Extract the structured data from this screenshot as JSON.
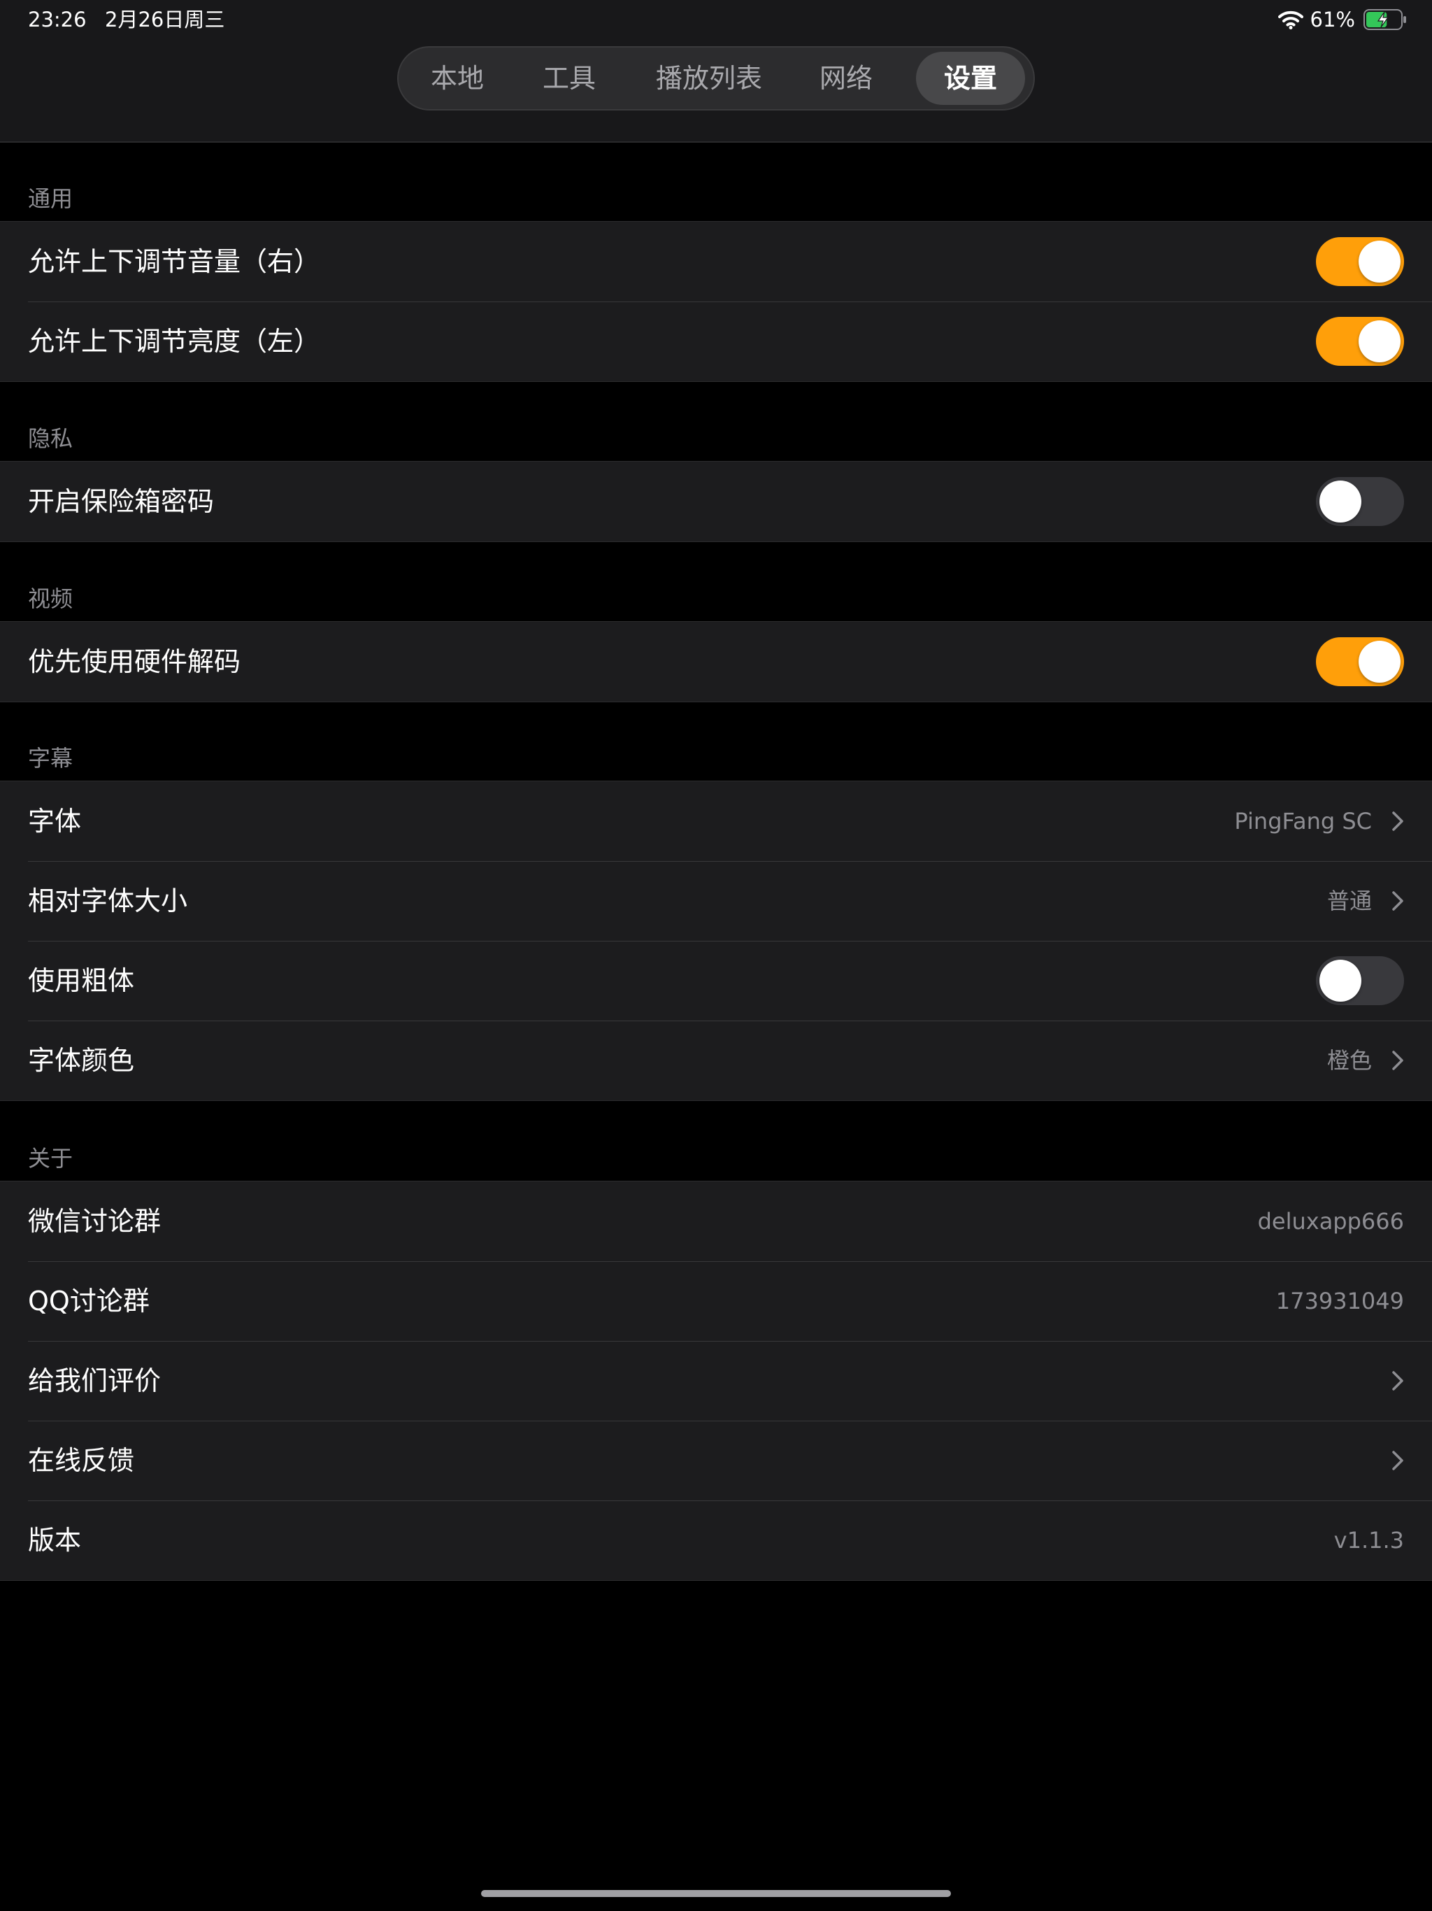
{
  "status_bar": {
    "time": "23:26",
    "date": "2月26日周三",
    "battery_percent": "61%",
    "battery_level": 0.61,
    "charging": true
  },
  "tabs": [
    {
      "label": "本地",
      "active": false
    },
    {
      "label": "工具",
      "active": false
    },
    {
      "label": "播放列表",
      "active": false
    },
    {
      "label": "网络",
      "active": false
    },
    {
      "label": "设置",
      "active": true
    }
  ],
  "sections": {
    "general": {
      "header": "通用",
      "rows": [
        {
          "label": "允许上下调节音量（右）",
          "toggle": true
        },
        {
          "label": "允许上下调节亮度（左）",
          "toggle": true
        }
      ]
    },
    "privacy": {
      "header": "隐私",
      "rows": [
        {
          "label": "开启保险箱密码",
          "toggle": false
        }
      ]
    },
    "video": {
      "header": "视频",
      "rows": [
        {
          "label": "优先使用硬件解码",
          "toggle": true
        }
      ]
    },
    "subtitles": {
      "header": "字幕",
      "rows": [
        {
          "label": "字体",
          "value": "PingFang SC"
        },
        {
          "label": "相对字体大小",
          "value": "普通"
        },
        {
          "label": "使用粗体",
          "toggle": false
        },
        {
          "label": "字体颜色",
          "value": "橙色"
        }
      ]
    },
    "about": {
      "header": "关于",
      "rows": [
        {
          "label": "微信讨论群",
          "value": "deluxapp666"
        },
        {
          "label": "QQ讨论群",
          "value": "173931049"
        },
        {
          "label": "给我们评价"
        },
        {
          "label": "在线反馈"
        },
        {
          "label": "版本",
          "value": "v1.1.3"
        }
      ]
    }
  },
  "icons": {
    "wifi": "wifi-icon",
    "battery": "battery-charging-icon",
    "chevron": "chevron-right-icon"
  },
  "colors": {
    "accent": "#ff9f0a",
    "background": "#000000",
    "cell": "#1c1c1e",
    "secondary_text": "#8e8e93",
    "battery_fill": "#34c759"
  }
}
